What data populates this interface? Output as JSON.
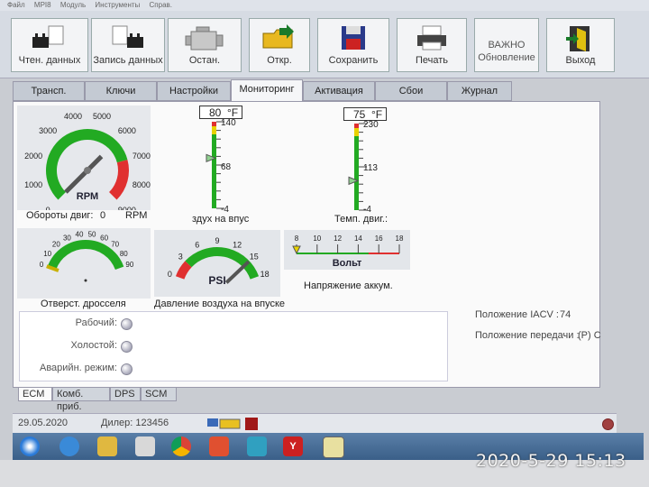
{
  "menubar": {
    "items": [
      "Файл",
      "MPI8",
      "Модуль",
      "Инструменты",
      "Справ."
    ]
  },
  "toolbar": {
    "read_data": "Чтен. данных",
    "record_data": "Запись данных",
    "stop": "Остан.",
    "open": "Откр.",
    "save": "Сохранить",
    "print": "Печать",
    "important_line1": "ВАЖНО",
    "important_line2": "Обновление",
    "exit": "Выход"
  },
  "tabs": [
    "Трансп.",
    "Ключи",
    "Настройки",
    "Мониторинг",
    "Активация",
    "Сбои",
    "Журнал"
  ],
  "active_tab": "Мониторинг",
  "rpm_gauge": {
    "ticks": [
      "0",
      "1000",
      "2000",
      "3000",
      "4000",
      "5000",
      "6000",
      "7000",
      "8000",
      "9000"
    ],
    "unit": "RPM",
    "label": "Обороты двиг:",
    "value": "0",
    "value_unit": "RPM",
    "needle_value": 0
  },
  "intake_temp": {
    "readout": "80",
    "unit": "°F",
    "top": "140",
    "mid": "68",
    "bottom": "-4",
    "label": "здух на впус",
    "level": 0.58
  },
  "coolant_temp": {
    "readout": "75",
    "unit": "°F",
    "top": "230",
    "mid": "113",
    "bottom": "-4",
    "label": "Темп. двиг.:",
    "level": 0.34
  },
  "throttle_gauge": {
    "ticks": [
      "0",
      "10",
      "20",
      "30",
      "40",
      "50",
      "60",
      "70",
      "80",
      "90"
    ],
    "label": "Отверст. дросселя",
    "needle_value": 0
  },
  "boost_gauge": {
    "ticks": [
      "0",
      "3",
      "6",
      "9",
      "12",
      "15",
      "18"
    ],
    "unit": "PSI",
    "label": "Давление воздуха на впуске",
    "needle_value": 15
  },
  "volt_gauge": {
    "ticks": [
      "8",
      "10",
      "12",
      "14",
      "16",
      "18"
    ],
    "unit": "Вольт",
    "label": "Напряжение аккум.",
    "needle_value": 8
  },
  "indicators": {
    "working": "Рабочий:",
    "idle": "Холостой:",
    "emergency": "Аварийн. режим:"
  },
  "readouts": {
    "iacv_label": "Положение IACV :",
    "iacv_value": "74",
    "gear_label": "Положение передачи :",
    "gear_value": "(P) C"
  },
  "bottom_tabs": [
    "ECM",
    "Комб. приб.",
    "DPS",
    "SCM"
  ],
  "status": {
    "date": "29.05.2020",
    "dealer": "Дилер: 123456"
  },
  "photo_stamp": "2020-5-29 15:13",
  "colors": {
    "green": "#22aa22",
    "red": "#e03030",
    "accent": "#3a5f88"
  }
}
